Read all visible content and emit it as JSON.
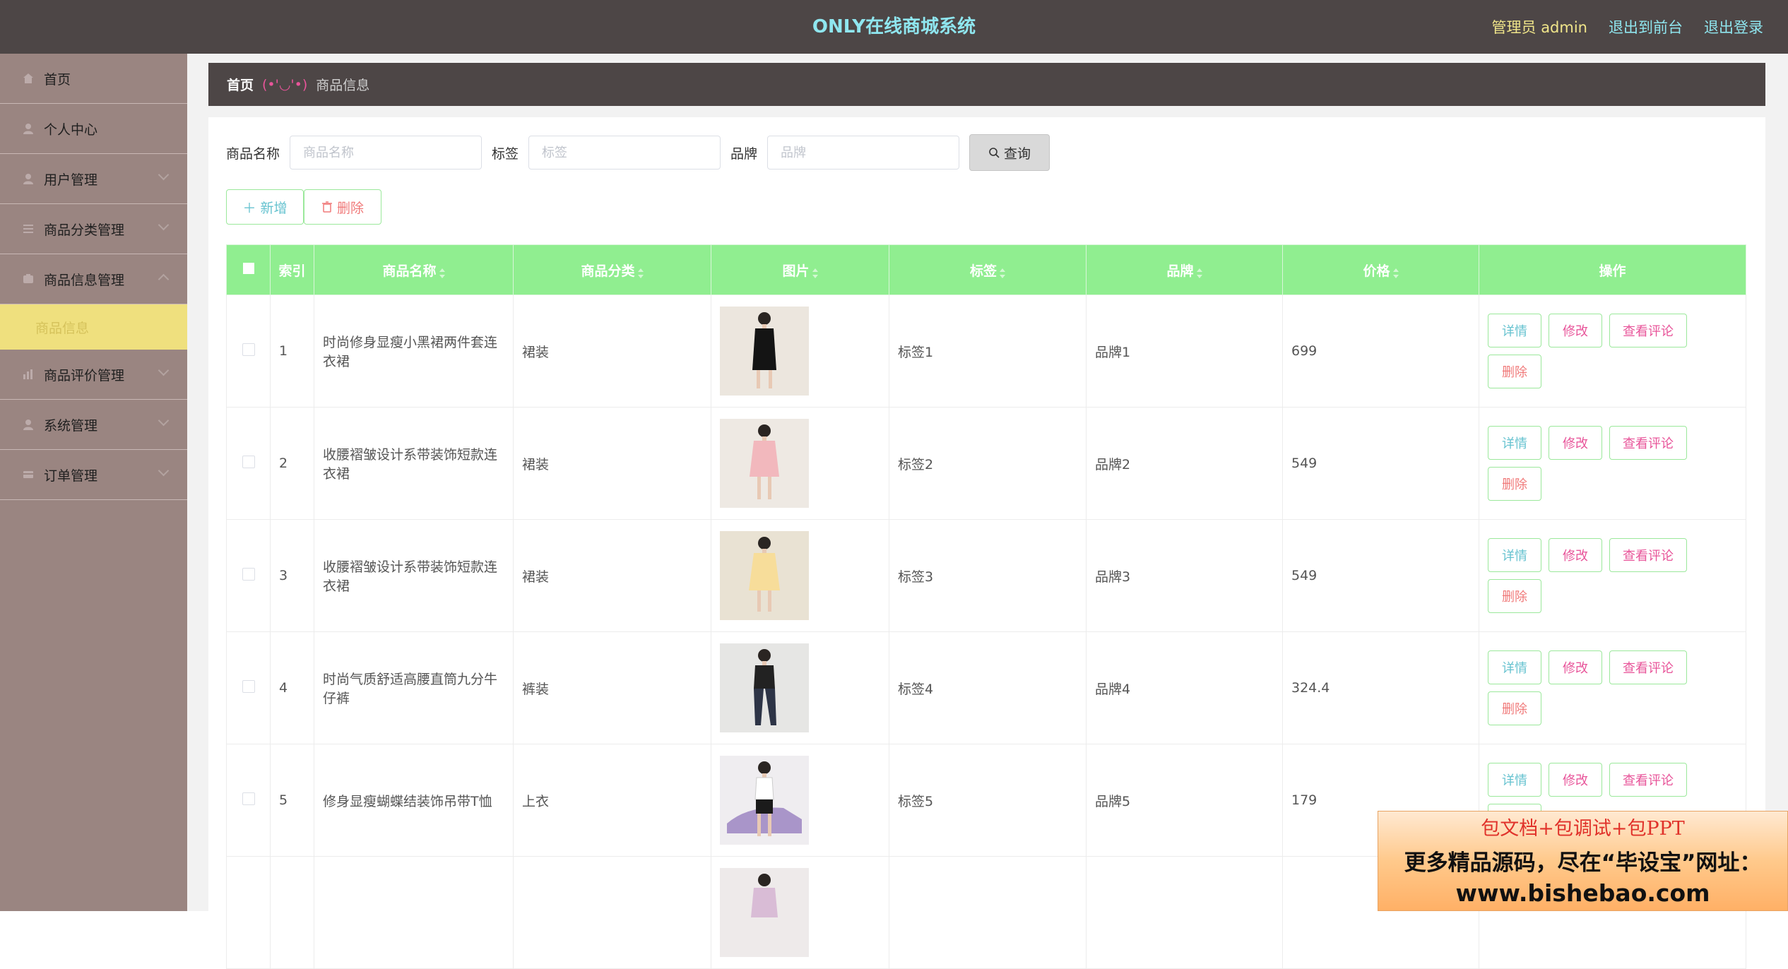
{
  "header": {
    "title": "ONLY在线商城系统",
    "admin_label": "管理员 admin",
    "back_to_front": "退出到前台",
    "logout": "退出登录"
  },
  "sidebar": {
    "items": [
      {
        "label": "首页",
        "icon": "home-icon"
      },
      {
        "label": "个人中心",
        "icon": "user-icon"
      },
      {
        "label": "用户管理",
        "icon": "user-icon"
      },
      {
        "label": "商品分类管理",
        "icon": "list-icon"
      },
      {
        "label": "商品信息管理",
        "icon": "box-icon"
      },
      {
        "label": "商品信息",
        "icon": ""
      },
      {
        "label": "商品评价管理",
        "icon": "chart-icon"
      },
      {
        "label": "系统管理",
        "icon": "user-icon"
      },
      {
        "label": "订单管理",
        "icon": "order-icon"
      }
    ]
  },
  "breadcrumb": {
    "home": "首页",
    "separator": "(•'◡'•)",
    "current": "商品信息"
  },
  "search": {
    "name_label": "商品名称",
    "name_placeholder": "商品名称",
    "tag_label": "标签",
    "tag_placeholder": "标签",
    "brand_label": "品牌",
    "brand_placeholder": "品牌",
    "query_button": "查询"
  },
  "toolbar": {
    "add_label": "新增",
    "delete_label": "删除"
  },
  "table": {
    "headers": [
      "索引",
      "商品名称",
      "商品分类",
      "图片",
      "标签",
      "品牌",
      "价格",
      "操作"
    ],
    "action_labels": {
      "detail": "详情",
      "edit": "修改",
      "reviews": "查看评论",
      "delete": "删除"
    },
    "rows": [
      {
        "index": "1",
        "name": "时尚修身显瘦小黑裙两件套连衣裙",
        "category": "裙装",
        "tag": "标签1",
        "brand": "品牌1",
        "price": "699",
        "image": "model-black-dress"
      },
      {
        "index": "2",
        "name": "收腰褶皱设计系带装饰短款连衣裙",
        "category": "裙装",
        "tag": "标签2",
        "brand": "品牌2",
        "price": "549",
        "image": "model-pink-dress"
      },
      {
        "index": "3",
        "name": "收腰褶皱设计系带装饰短款连衣裙",
        "category": "裙装",
        "tag": "标签3",
        "brand": "品牌3",
        "price": "549",
        "image": "model-yellow-dress"
      },
      {
        "index": "4",
        "name": "时尚气质舒适高腰直筒九分牛仔裤",
        "category": "裤装",
        "tag": "标签4",
        "brand": "品牌4",
        "price": "324.4",
        "image": "model-dark-jeans"
      },
      {
        "index": "5",
        "name": "修身显瘦蝴蝶结装饰吊带T恤",
        "category": "上衣",
        "tag": "标签5",
        "brand": "品牌5",
        "price": "179",
        "image": "model-purple-car"
      }
    ]
  },
  "ad": {
    "line1": "包文档+包调试+包PPT",
    "line2": "更多精品源码，尽在“毕设宝”网址：",
    "line3": "www.bishebao.com"
  },
  "colors": {
    "topbar": "#4d4646",
    "title": "#8fe6ef",
    "sidebar": "#9a8581",
    "active_sub": "#efe07e",
    "table_header": "#90ee90"
  }
}
